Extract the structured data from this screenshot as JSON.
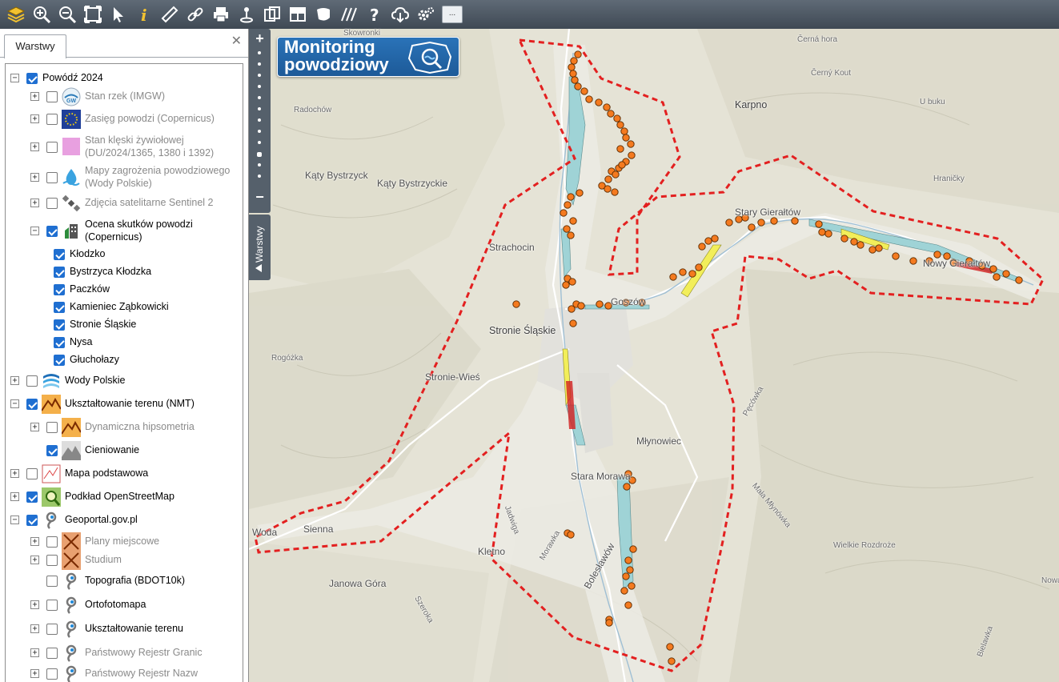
{
  "toolbar": {
    "more_label": "...",
    "buttons": [
      "layers-icon",
      "zoom-in-icon",
      "zoom-out-icon",
      "zoom-extent-icon",
      "pointer-icon",
      "info-icon",
      "measure-ruler-icon",
      "link-icon",
      "print-icon",
      "location-pin-icon",
      "copy-icon",
      "layout-icon",
      "shape-icon",
      "hatch-icon",
      "help-icon",
      "cloud-download-icon",
      "settings-icon"
    ]
  },
  "panel": {
    "tab_label": "Warstwy",
    "close_glyph": "✕",
    "tree": [
      {
        "label": "Powódź 2024"
      },
      {
        "label": "Stan rzek (IMGW)"
      },
      {
        "label": "Zasięg powodzi (Copernicus)"
      },
      {
        "label": "Stan klęski żywiołowej",
        "label2": "(DU/2024/1365, 1380 i 1392)"
      },
      {
        "label": "Mapy zagrożenia powodziowego",
        "label2": "(Wody Polskie)"
      },
      {
        "label": "Zdjęcia satelitarne Sentinel 2"
      },
      {
        "label": "Ocena skutków powodzi",
        "label2": "(Copernicus)"
      },
      {
        "label": "Kłodzko"
      },
      {
        "label": "Bystrzyca Kłodzka"
      },
      {
        "label": "Paczków"
      },
      {
        "label": "Kamieniec Ząbkowicki"
      },
      {
        "label": "Stronie Śląskie"
      },
      {
        "label": "Nysa"
      },
      {
        "label": "Głuchołazy"
      },
      {
        "label": "Wody Polskie"
      },
      {
        "label": "Ukształtowanie terenu (NMT)"
      },
      {
        "label": "Dynamiczna hipsometria"
      },
      {
        "label": "Cieniowanie"
      },
      {
        "label": "Mapa podstawowa"
      },
      {
        "label": "Podkład OpenStreetMap"
      },
      {
        "label": "Geoportal.gov.pl"
      },
      {
        "label": "Plany miejscowe"
      },
      {
        "label": "Studium"
      },
      {
        "label": "Topografia (BDOT10k)"
      },
      {
        "label": "Ortofotomapa"
      },
      {
        "label": "Ukształtowanie terenu"
      },
      {
        "label": "Państwowy Rejestr Granic"
      },
      {
        "label": "Państwowy Rejestr Nazw"
      }
    ]
  },
  "map": {
    "zoom_in": "+",
    "zoom_out": "−",
    "side_tab_label": "Warstwy",
    "logo_line1": "Monitoring",
    "logo_line2": "powodziowy",
    "place_labels": [
      "Skowronki",
      "Černá hora",
      "Černý Kout",
      "U buku",
      "Radochów",
      "Karpno",
      "Kąty Bystrzyck",
      "Kąty Bystrzyckie",
      "Hraničky",
      "Stary Gierałtów",
      "Strachocin",
      "Nowy Gierałtów",
      "Goszów",
      "Stronie Śląskie",
      "Rogóżka",
      "Stronie-Wieś",
      "Młynowiec",
      "Stara Morawa",
      "Mała Młynówka",
      "Wielkie Rozdroże",
      "Sienna",
      "Kletno",
      "Bolesławów",
      "Nowa Bie",
      "Janowa Góra",
      "Woda",
      "Jadwiga",
      "Morawka",
      "Szeroka",
      "Pęcówka",
      "Bielawka"
    ],
    "colors": {
      "boundary": "#e32020",
      "point": "#f47a1f",
      "point_stroke": "#5a2a00",
      "flood_yellow": "#f2ee5a",
      "flood_blue": "#9fd3d6",
      "flood_red": "#d21f1f"
    }
  }
}
